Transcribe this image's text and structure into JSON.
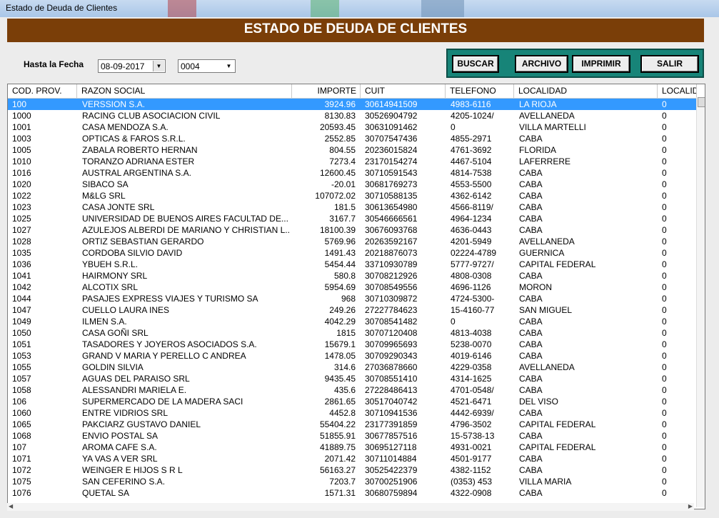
{
  "window": {
    "title": "Estado de Deuda de Clientes"
  },
  "banner": {
    "title": "ESTADO DE DEUDA DE CLIENTES"
  },
  "filter": {
    "date_label": "Hasta la Fecha",
    "date_value": "08-09-2017",
    "code_value": "0004"
  },
  "buttons": {
    "buscar": "BUSCAR",
    "archivo": "ARCHIVO",
    "imprimir": "IMPRIMIR",
    "salir": "SALIR"
  },
  "colors": {
    "banner": "#7a3e08",
    "panel": "#178478",
    "selection": "#3399ff"
  },
  "table": {
    "columns": [
      "COD. PROV.",
      "RAZON SOCIAL",
      "IMPORTE",
      "CUIT",
      "TELEFONO",
      "LOCALIDAD",
      "LOCALID"
    ],
    "rows": [
      [
        "100",
        "VERSSION S.A.",
        "3924.96",
        "30614941509",
        "4983-6116",
        "LA RIOJA",
        "0"
      ],
      [
        "1000",
        "RACING CLUB ASOCIACION CIVIL",
        "8130.83",
        "30526904792",
        "4205-1024/",
        "AVELLANEDA",
        "0"
      ],
      [
        "1001",
        "CASA MENDOZA S.A.",
        "20593.45",
        "30631091462",
        "0",
        "VILLA MARTELLI",
        "0"
      ],
      [
        "1003",
        "OPTICAS & FAROS S.R.L.",
        "2552.85",
        "30707547436",
        "4855-2971",
        "CABA",
        "0"
      ],
      [
        "1005",
        "ZABALA ROBERTO HERNAN",
        "804.55",
        "20236015824",
        "4761-3692",
        "FLORIDA",
        "0"
      ],
      [
        "1010",
        "TORANZO ADRIANA ESTER",
        "7273.4",
        "23170154274",
        "4467-5104",
        "LAFERRERE",
        "0"
      ],
      [
        "1016",
        "AUSTRAL ARGENTINA S.A.",
        "12600.45",
        "30710591543",
        "4814-7538",
        "CABA",
        "0"
      ],
      [
        "1020",
        "SIBACO SA",
        "-20.01",
        "30681769273",
        "4553-5500",
        "CABA",
        "0"
      ],
      [
        "1022",
        "M&LG SRL",
        "107072.02",
        "30710588135",
        "4362-6142",
        "CABA",
        "0"
      ],
      [
        "1023",
        "CASA JONTE SRL",
        "181.5",
        "30613654980",
        "4566-8119/",
        "CABA",
        "0"
      ],
      [
        "1025",
        "UNIVERSIDAD DE BUENOS AIRES FACULTAD DE...",
        "3167.7",
        "30546666561",
        "4964-1234",
        "CABA",
        "0"
      ],
      [
        "1027",
        "AZULEJOS ALBERDI DE MARIANO Y CHRISTIAN L...",
        "18100.39",
        "30676093768",
        "4636-0443",
        "CABA",
        "0"
      ],
      [
        "1028",
        "ORTIZ SEBASTIAN GERARDO",
        "5769.96",
        "20263592167",
        "4201-5949",
        "AVELLANEDA",
        "0"
      ],
      [
        "1035",
        "CORDOBA SILVIO DAVID",
        "1491.43",
        "20218876073",
        "02224-4789",
        "GUERNICA",
        "0"
      ],
      [
        "1036",
        "YBUEH S.R.L.",
        "5454.44",
        "33710930789",
        "5777-9727/",
        "CAPITAL FEDERAL",
        "0"
      ],
      [
        "1041",
        "HAIRMONY SRL",
        "580.8",
        "30708212926",
        "4808-0308",
        "CABA",
        "0"
      ],
      [
        "1042",
        "ALCOTIX SRL",
        "5954.69",
        "30708549556",
        "4696-1126",
        "MORON",
        "0"
      ],
      [
        "1044",
        "PASAJES EXPRESS VIAJES Y TURISMO SA",
        "968",
        "30710309872",
        "4724-5300-",
        "CABA",
        "0"
      ],
      [
        "1047",
        "CUELLO LAURA INES",
        "249.26",
        "27227784623",
        "15-4160-77",
        "SAN MIGUEL",
        "0"
      ],
      [
        "1049",
        "ILMEN S.A.",
        "4042.29",
        "30708541482",
        "0",
        "CABA",
        "0"
      ],
      [
        "1050",
        "CASA GOÑI SRL",
        "1815",
        "30707120408",
        "4813-4038",
        "CABA",
        "0"
      ],
      [
        "1051",
        "TASADORES Y JOYEROS ASOCIADOS S.A.",
        "15679.1",
        "30709965693",
        "5238-0070",
        "CABA",
        "0"
      ],
      [
        "1053",
        "GRAND V MARIA Y PERELLO C ANDREA",
        "1478.05",
        "30709290343",
        "4019-6146",
        "CABA",
        "0"
      ],
      [
        "1055",
        "GOLDIN SILVIA",
        "314.6",
        "27036878660",
        "4229-0358",
        "AVELLANEDA",
        "0"
      ],
      [
        "1057",
        "AGUAS DEL PARAISO SRL",
        "9435.45",
        "30708551410",
        "4314-1625",
        "CABA",
        "0"
      ],
      [
        "1058",
        "ALESSANDRI MARIELA E.",
        "435.6",
        "27228486413",
        "4701-0548/",
        "CABA",
        "0"
      ],
      [
        "106",
        "SUPERMERCADO DE LA MADERA SACI",
        "2861.65",
        "30517040742",
        "4521-6471",
        "DEL VISO",
        "0"
      ],
      [
        "1060",
        "ENTRE VIDRIOS SRL",
        "4452.8",
        "30710941536",
        "4442-6939/",
        "CABA",
        "0"
      ],
      [
        "1065",
        "PAKCIARZ GUSTAVO DANIEL",
        "55404.22",
        "23177391859",
        "4796-3502",
        "CAPITAL FEDERAL",
        "0"
      ],
      [
        "1068",
        "ENVIO POSTAL SA",
        "51855.91",
        "30677857516",
        "15-5738-13",
        "CABA",
        "0"
      ],
      [
        "107",
        "AROMA CAFE S.A.",
        "41889.75",
        "30695127118",
        "4931-0021",
        "CAPITAL FEDERAL",
        "0"
      ],
      [
        "1071",
        "YA VAS A VER SRL",
        "2071.42",
        "30711014884",
        "4501-9177",
        "CABA",
        "0"
      ],
      [
        "1072",
        "WEINGER E HIJOS S R L",
        "56163.27",
        "30525422379",
        "4382-1152",
        "CABA",
        "0"
      ],
      [
        "1075",
        "SAN CEFERINO S.A.",
        "7203.7",
        "30700251906",
        "(0353) 453",
        "VILLA MARIA",
        "0"
      ],
      [
        "1076",
        "QUETAL SA",
        "1571.31",
        "30680759894",
        "4322-0908",
        "CABA",
        "0"
      ]
    ]
  }
}
